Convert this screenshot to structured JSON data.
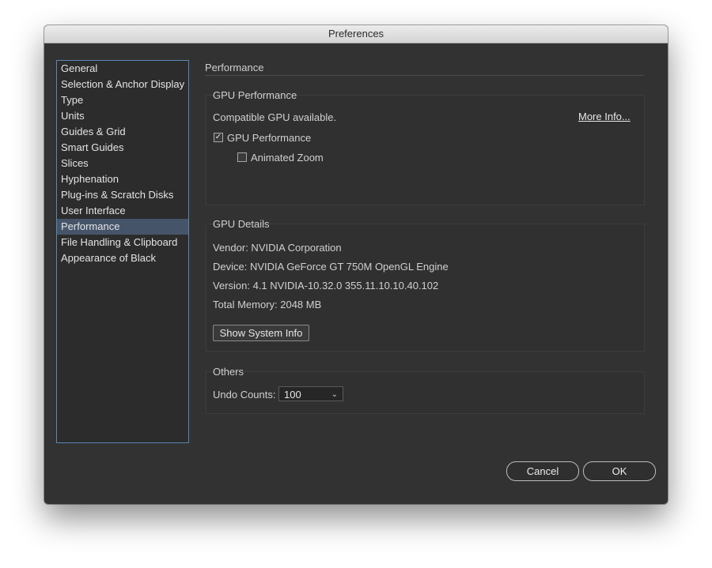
{
  "window": {
    "title": "Preferences"
  },
  "sidebar": {
    "items": [
      {
        "label": "General"
      },
      {
        "label": "Selection & Anchor Display"
      },
      {
        "label": "Type"
      },
      {
        "label": "Units"
      },
      {
        "label": "Guides & Grid"
      },
      {
        "label": "Smart Guides"
      },
      {
        "label": "Slices"
      },
      {
        "label": "Hyphenation"
      },
      {
        "label": "Plug-ins & Scratch Disks"
      },
      {
        "label": "User Interface"
      },
      {
        "label": "Performance",
        "selected": true
      },
      {
        "label": "File Handling & Clipboard"
      },
      {
        "label": "Appearance of Black"
      }
    ]
  },
  "panel": {
    "heading": "Performance",
    "gpu_performance": {
      "title": "GPU Performance",
      "status": "Compatible GPU available.",
      "more_info": "More Info...",
      "gpu_checkbox": {
        "label": "GPU Performance",
        "checked": true
      },
      "zoom_checkbox": {
        "label": "Animated Zoom",
        "checked": false
      }
    },
    "gpu_details": {
      "title": "GPU Details",
      "vendor": "Vendor: NVIDIA Corporation",
      "device": "Device: NVIDIA GeForce GT 750M OpenGL Engine",
      "version": "Version: 4.1 NVIDIA-10.32.0 355.11.10.10.40.102",
      "memory": "Total Memory: 2048 MB",
      "system_info_button": "Show System Info"
    },
    "others": {
      "title": "Others",
      "undo_label": "Undo Counts:",
      "undo_value": "100"
    }
  },
  "footer": {
    "cancel": "Cancel",
    "ok": "OK"
  },
  "colors": {
    "window_bg": "#323232",
    "selection": "#46546a",
    "sidebar_border": "#5a86b5"
  }
}
